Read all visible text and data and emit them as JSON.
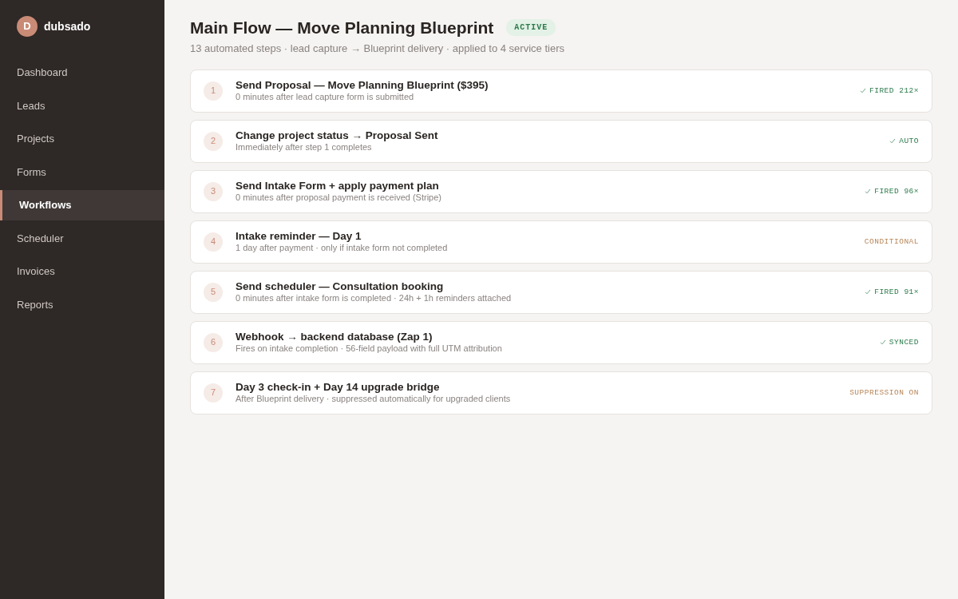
{
  "sidebar": {
    "logo_letter": "D",
    "brand": "dubsado",
    "items": [
      {
        "label": "Dashboard",
        "selected": false
      },
      {
        "label": "Leads",
        "selected": false
      },
      {
        "label": "Projects",
        "selected": false
      },
      {
        "label": "Forms",
        "selected": false
      },
      {
        "label": "Workflows",
        "selected": true
      },
      {
        "label": "Scheduler",
        "selected": false
      },
      {
        "label": "Invoices",
        "selected": false
      },
      {
        "label": "Reports",
        "selected": false
      }
    ]
  },
  "header": {
    "title": "Main Flow — Move Planning Blueprint",
    "badge": "ACTIVE",
    "subtitle": "13 automated steps · lead capture → Blueprint delivery · applied to 4 service tiers"
  },
  "steps": [
    {
      "number": "1",
      "title": "Send Proposal — Move Planning Blueprint ($395)",
      "detail": "0 minutes after lead capture form is submitted",
      "status": "FIRED 212×",
      "kind": "done"
    },
    {
      "number": "2",
      "title": "Change project status → Proposal Sent",
      "detail": "Immediately after step 1 completes",
      "status": "AUTO",
      "kind": "done"
    },
    {
      "number": "3",
      "title": "Send Intake Form + apply payment plan",
      "detail": "0 minutes after proposal payment is received (Stripe)",
      "status": "FIRED 96×",
      "kind": "done"
    },
    {
      "number": "4",
      "title": "Intake reminder — Day 1",
      "detail": "1 day after payment · only if intake form not completed",
      "status": "CONDITIONAL",
      "kind": "pending"
    },
    {
      "number": "5",
      "title": "Send scheduler — Consultation booking",
      "detail": "0 minutes after intake form is completed · 24h + 1h reminders attached",
      "status": "FIRED 91×",
      "kind": "done"
    },
    {
      "number": "6",
      "title": "Webhook → backend database (Zap 1)",
      "detail": "Fires on intake completion · 56-field payload with full UTM attribution",
      "status": "SYNCED",
      "kind": "done"
    },
    {
      "number": "7",
      "title": "Day 3 check-in + Day 14 upgrade bridge",
      "detail": "After Blueprint delivery · suppressed automatically for upgraded clients",
      "status": "SUPPRESSION ON",
      "kind": "pending"
    }
  ]
}
